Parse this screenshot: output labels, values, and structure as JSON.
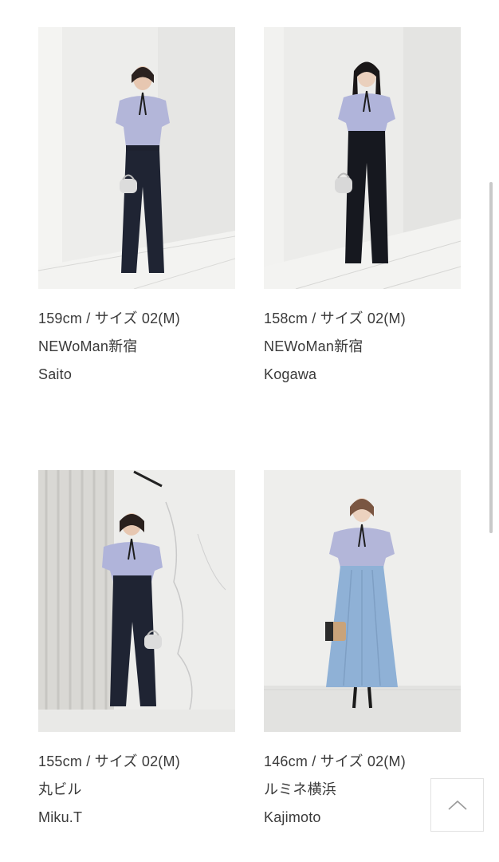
{
  "staff": [
    {
      "height_size": "159cm  / サイズ 02(M)",
      "store": "NEWoMan新宿",
      "name": "Saito",
      "photo_alt": "staff-photo-saito"
    },
    {
      "height_size": "158cm  / サイズ 02(M)",
      "store": "NEWoMan新宿",
      "name": "Kogawa",
      "photo_alt": "staff-photo-kogawa"
    },
    {
      "height_size": "155cm  / サイズ 02(M)",
      "store": "丸ビル",
      "name": "Miku.T",
      "photo_alt": "staff-photo-miku"
    },
    {
      "height_size": "146cm  / サイズ 02(M)",
      "store": "ルミネ横浜",
      "name": "Kajimoto",
      "photo_alt": "staff-photo-kajimoto"
    }
  ],
  "icons": {
    "back_to_top": "chevron-up-icon"
  },
  "colors": {
    "text": "#3a3a3a",
    "blouse": "#aab0d6",
    "pants_navy": "#1f2433",
    "skirt_blue": "#8fb1d6",
    "wall": "#ececea"
  }
}
